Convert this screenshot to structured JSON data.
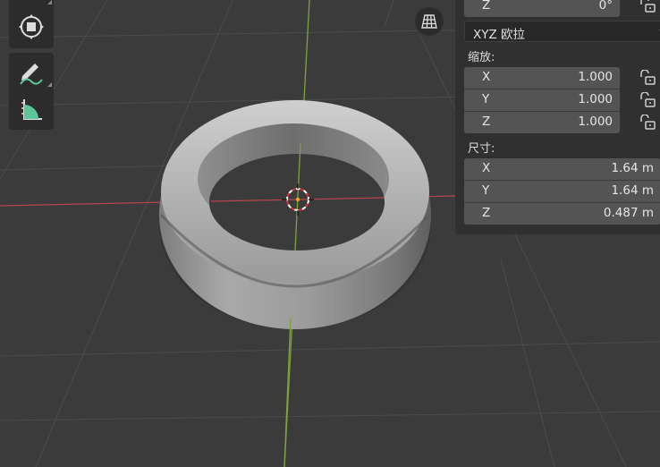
{
  "viewport": {
    "background": "#3b3b3b",
    "grid_color": "#4a4a4a",
    "x_axis_color": "#b5454f",
    "y_axis_color": "#7ea33a",
    "object": "torus"
  },
  "toolbar": {
    "icons": [
      "transform-icon",
      "annotate-icon",
      "measure-icon"
    ]
  },
  "perspective_toggle": {
    "icon": "grid-perspective-icon"
  },
  "n_panel": {
    "rotation_z": {
      "label": "Z",
      "value": "0°"
    },
    "rotation_mode": {
      "value": "XYZ 欧拉"
    },
    "scale": {
      "header": "缩放:",
      "x": {
        "label": "X",
        "value": "1.000"
      },
      "y": {
        "label": "Y",
        "value": "1.000"
      },
      "z": {
        "label": "Z",
        "value": "1.000"
      }
    },
    "dimensions": {
      "header": "尺寸:",
      "x": {
        "label": "X",
        "value": "1.64 m"
      },
      "y": {
        "label": "Y",
        "value": "1.64 m"
      },
      "z": {
        "label": "Z",
        "value": "0.487 m"
      }
    }
  }
}
